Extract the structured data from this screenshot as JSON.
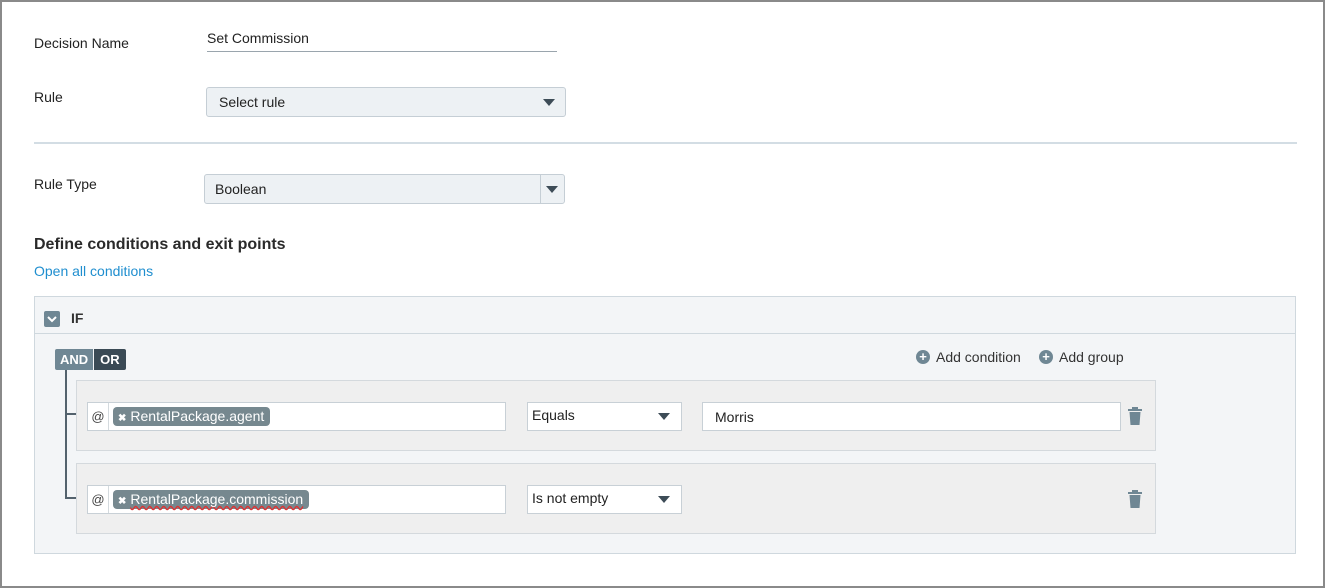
{
  "form": {
    "decision_name_label": "Decision Name",
    "decision_name_value": "Set Commission",
    "rule_label": "Rule",
    "rule_value": "Select rule",
    "rule_type_label": "Rule Type",
    "rule_type_value": "Boolean"
  },
  "conditions": {
    "title": "Define conditions and exit points",
    "open_all_link": "Open all conditions",
    "if_label": "IF",
    "and_label": "AND",
    "or_label": "OR",
    "add_condition_label": "Add condition",
    "add_group_label": "Add group",
    "rows": [
      {
        "at_symbol": "@",
        "field": "RentalPackage.agent",
        "operator": "Equals",
        "value": "Morris"
      },
      {
        "at_symbol": "@",
        "field": "RentalPackage.commission",
        "operator": "Is not empty",
        "value": ""
      }
    ]
  },
  "icons": {
    "dropdown": "chevron-down-icon",
    "collapse": "chevron-down-icon",
    "add": "plus-circle-icon",
    "remove_chip": "close-icon",
    "delete": "trash-icon"
  },
  "colors": {
    "accent": "#6f8794",
    "link": "#1f8ecf",
    "or_active": "#3a4a55",
    "chip": "#76888f"
  }
}
